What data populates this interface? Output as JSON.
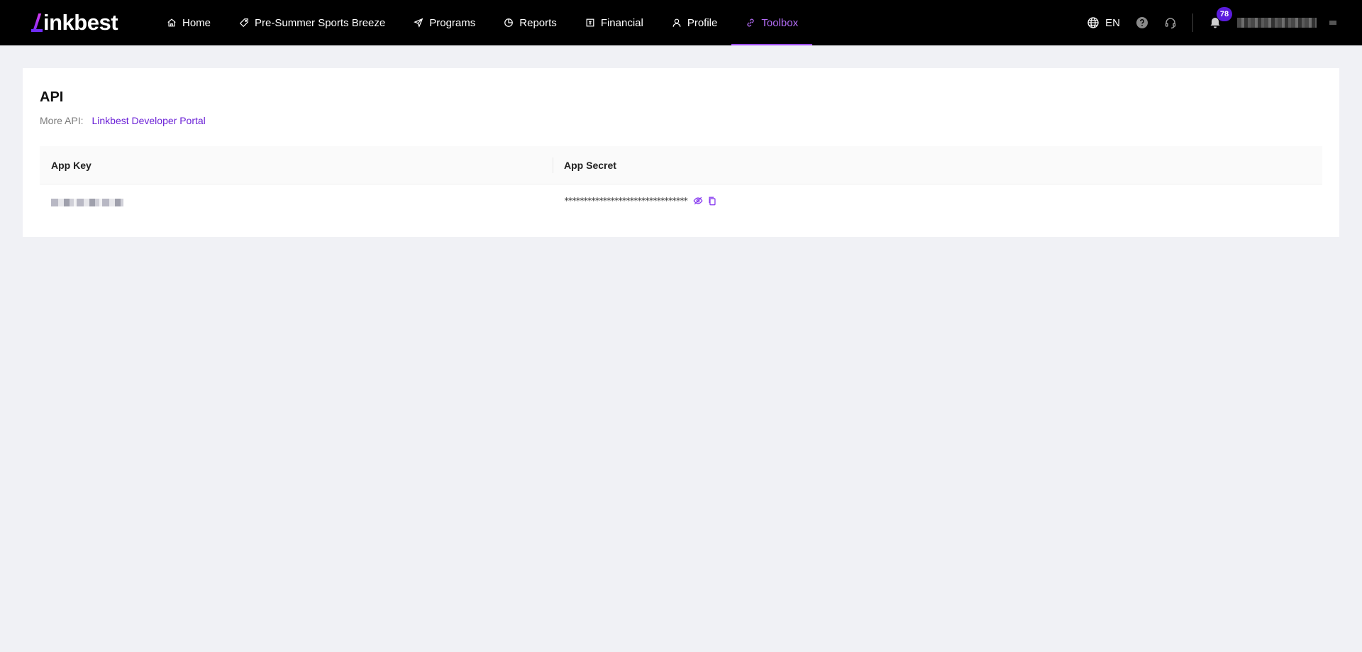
{
  "brand": {
    "logo_text": "inkbest",
    "accent": "#9d4cf2"
  },
  "nav": {
    "items": [
      {
        "label": "Home",
        "icon": "home-icon"
      },
      {
        "label": "Pre-Summer Sports Breeze",
        "icon": "tag-icon"
      },
      {
        "label": "Programs",
        "icon": "send-icon"
      },
      {
        "label": "Reports",
        "icon": "pie-chart-icon"
      },
      {
        "label": "Financial",
        "icon": "wallet-icon"
      },
      {
        "label": "Profile",
        "icon": "user-icon"
      },
      {
        "label": "Toolbox",
        "icon": "link-icon",
        "active": true
      }
    ]
  },
  "header_tools": {
    "language": "EN",
    "notification_count": "78"
  },
  "page": {
    "title": "API",
    "more_api_label": "More API:",
    "developer_portal_link": "Linkbest Developer Portal"
  },
  "table": {
    "columns": [
      "App Key",
      "App Secret"
    ],
    "rows": [
      {
        "app_key": "",
        "app_secret": "********************************"
      }
    ]
  }
}
